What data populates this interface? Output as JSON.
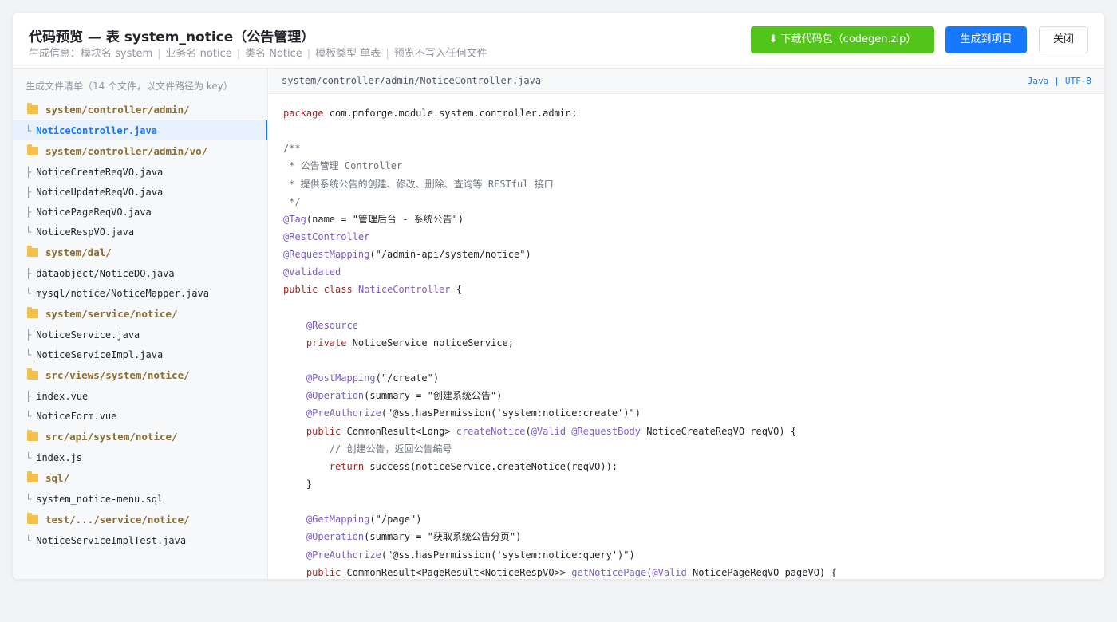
{
  "header": {
    "title": "代码预览 — 表 system_notice（公告管理）",
    "meta": [
      "生成信息：模块名 system",
      "业务名 notice",
      "类名 Notice",
      "模板类型 单表",
      "预览不写入任何文件"
    ],
    "meta_separator": "|",
    "download_label": "下载代码包（codegen.zip）",
    "generate_label": "生成到项目",
    "close_label": "关闭"
  },
  "sidebar": {
    "heading": "生成文件清单（14 个文件，以文件路径为 key）",
    "tree": [
      {
        "type": "folder",
        "label": "system/controller/admin/"
      },
      {
        "type": "file",
        "branch": "└",
        "label": "NoticeController.java",
        "selected": true
      },
      {
        "type": "folder",
        "label": "system/controller/admin/vo/"
      },
      {
        "type": "file",
        "branch": "├",
        "label": "NoticeCreateReqVO.java"
      },
      {
        "type": "file",
        "branch": "├",
        "label": "NoticeUpdateReqVO.java"
      },
      {
        "type": "file",
        "branch": "├",
        "label": "NoticePageReqVO.java"
      },
      {
        "type": "file",
        "branch": "└",
        "label": "NoticeRespVO.java"
      },
      {
        "type": "folder",
        "label": "system/dal/"
      },
      {
        "type": "file",
        "branch": "├",
        "label": "dataobject/NoticeDO.java"
      },
      {
        "type": "file",
        "branch": "└",
        "label": "mysql/notice/NoticeMapper.java"
      },
      {
        "type": "folder",
        "label": "system/service/notice/"
      },
      {
        "type": "file",
        "branch": "├",
        "label": "NoticeService.java"
      },
      {
        "type": "file",
        "branch": "└",
        "label": "NoticeServiceImpl.java"
      },
      {
        "type": "folder",
        "label": "src/views/system/notice/"
      },
      {
        "type": "file",
        "branch": "├",
        "label": "index.vue"
      },
      {
        "type": "file",
        "branch": "└",
        "label": "NoticeForm.vue"
      },
      {
        "type": "folder",
        "label": "src/api/system/notice/"
      },
      {
        "type": "file",
        "branch": "└",
        "label": "index.js"
      },
      {
        "type": "folder",
        "label": "sql/"
      },
      {
        "type": "file",
        "branch": "└",
        "label": "system_notice-menu.sql"
      },
      {
        "type": "folder",
        "label": "test/.../service/notice/"
      },
      {
        "type": "file",
        "branch": "└",
        "label": "NoticeServiceImplTest.java"
      }
    ]
  },
  "viewer": {
    "file_path": "system/controller/admin/NoticeController.java",
    "language": "Java",
    "encoding": "UTF-8",
    "tag_separator": "|",
    "code_lines": [
      [
        [
          "kw2",
          "package"
        ],
        [
          "t",
          " com.pmforge.module.system.controller.admin;"
        ]
      ],
      [],
      [
        [
          "cm",
          "/**"
        ]
      ],
      [
        [
          "cm",
          " * 公告管理 Controller"
        ]
      ],
      [
        [
          "cm",
          " * 提供系统公告的创建、修改、删除、查询等 RESTful 接口"
        ]
      ],
      [
        [
          "cm",
          " */"
        ]
      ],
      [
        [
          "an",
          "@Tag"
        ],
        [
          "t",
          "(name = \"管理后台 - 系统公告\")"
        ]
      ],
      [
        [
          "an",
          "@RestController"
        ]
      ],
      [
        [
          "an",
          "@RequestMapping"
        ],
        [
          "t",
          "(\"/admin-api/system/notice\")"
        ]
      ],
      [
        [
          "an",
          "@Validated"
        ]
      ],
      [
        [
          "kw2",
          "public class"
        ],
        [
          "t",
          " "
        ],
        [
          "fn",
          "NoticeController"
        ],
        [
          "t",
          " {"
        ]
      ],
      [],
      [
        [
          "t",
          "    "
        ],
        [
          "an",
          "@Resource"
        ]
      ],
      [
        [
          "t",
          "    "
        ],
        [
          "kw2",
          "private"
        ],
        [
          "t",
          " NoticeService noticeService;"
        ]
      ],
      [],
      [
        [
          "t",
          "    "
        ],
        [
          "an",
          "@PostMapping"
        ],
        [
          "t",
          "(\"/create\")"
        ]
      ],
      [
        [
          "t",
          "    "
        ],
        [
          "an",
          "@Operation"
        ],
        [
          "t",
          "(summary = \"创建系统公告\")"
        ]
      ],
      [
        [
          "t",
          "    "
        ],
        [
          "an",
          "@PreAuthorize"
        ],
        [
          "t",
          "(\"@ss.hasPermission('system:notice:create')\")"
        ]
      ],
      [
        [
          "t",
          "    "
        ],
        [
          "kw2",
          "public"
        ],
        [
          "t",
          " CommonResult<Long> "
        ],
        [
          "fn",
          "createNotice"
        ],
        [
          "t",
          "("
        ],
        [
          "an",
          "@Valid"
        ],
        [
          "t",
          " "
        ],
        [
          "an",
          "@RequestBody"
        ],
        [
          "t",
          " NoticeCreateReqVO reqVO) {"
        ]
      ],
      [
        [
          "cm",
          "        // 创建公告，返回公告编号"
        ]
      ],
      [
        [
          "t",
          "        "
        ],
        [
          "kw2",
          "return"
        ],
        [
          "t",
          " success(noticeService.createNotice(reqVO));"
        ]
      ],
      [
        [
          "t",
          "    }"
        ]
      ],
      [],
      [
        [
          "t",
          "    "
        ],
        [
          "an",
          "@GetMapping"
        ],
        [
          "t",
          "(\"/page\")"
        ]
      ],
      [
        [
          "t",
          "    "
        ],
        [
          "an",
          "@Operation"
        ],
        [
          "t",
          "(summary = \"获取系统公告分页\")"
        ]
      ],
      [
        [
          "t",
          "    "
        ],
        [
          "an",
          "@PreAuthorize"
        ],
        [
          "t",
          "(\"@ss.hasPermission('system:notice:query')\")"
        ]
      ],
      [
        [
          "t",
          "    "
        ],
        [
          "kw2",
          "public"
        ],
        [
          "t",
          " CommonResult<PageResult<NoticeRespVO>> "
        ],
        [
          "fn",
          "getNoticePage"
        ],
        [
          "t",
          "("
        ],
        [
          "an",
          "@Valid"
        ],
        [
          "t",
          " NoticePageReqVO pageVO) {"
        ]
      ]
    ]
  }
}
